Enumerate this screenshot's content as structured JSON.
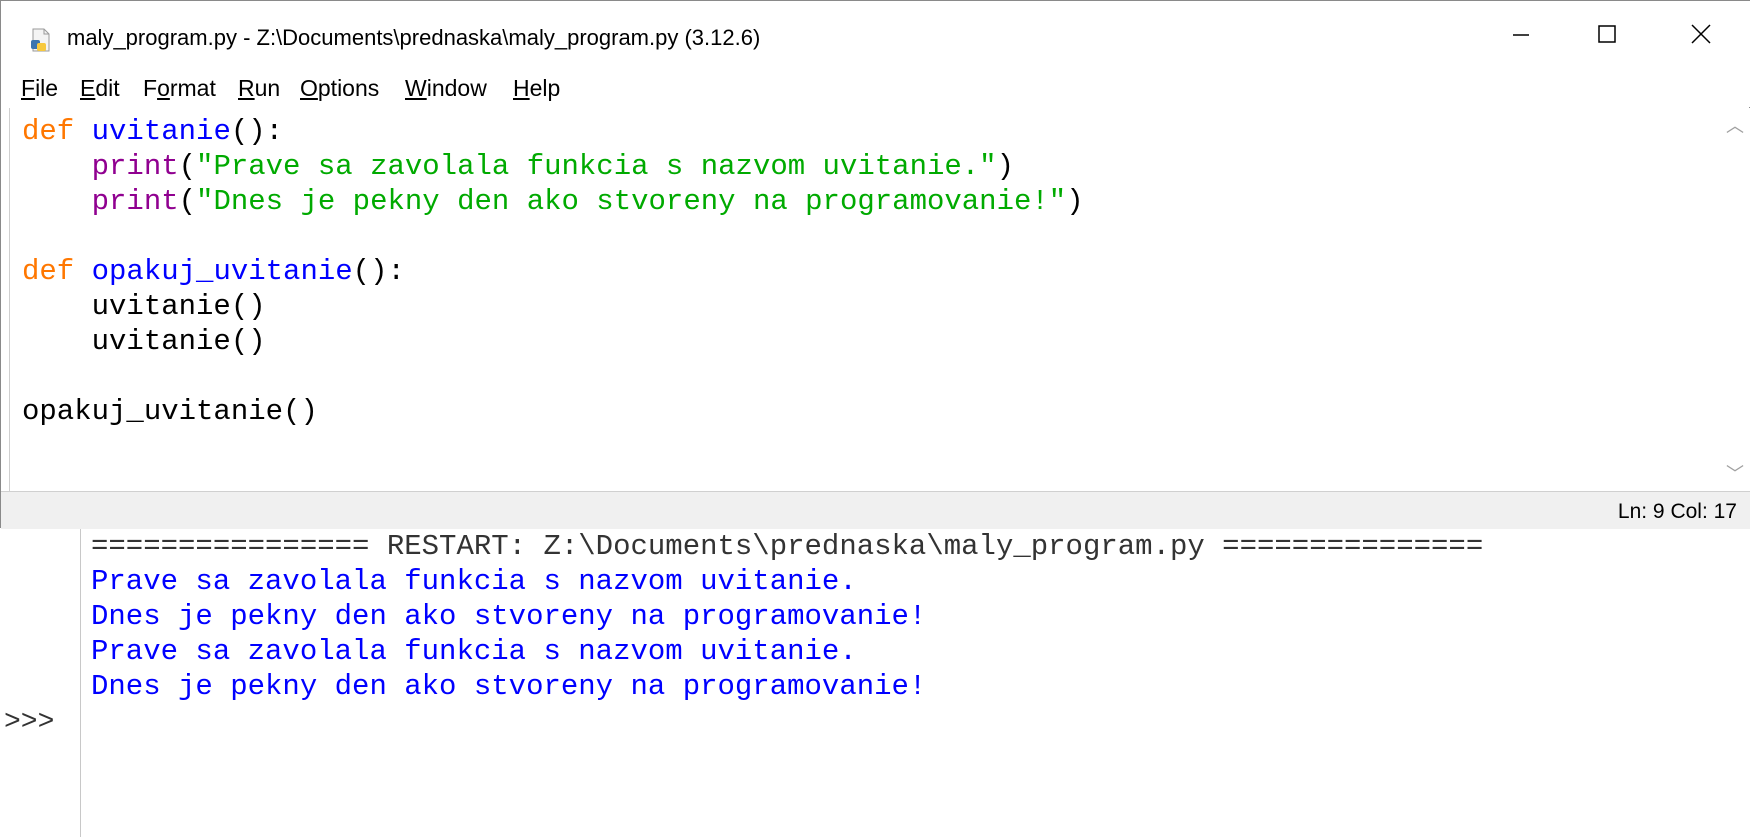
{
  "window": {
    "title": "maly_program.py - Z:\\Documents\\prednaska\\maly_program.py (3.12.6)",
    "icon": "python-file-icon"
  },
  "menu": [
    {
      "label": "File",
      "mnemonic": "F",
      "rest": "ile"
    },
    {
      "label": "Edit",
      "mnemonic": "E",
      "rest": "dit"
    },
    {
      "label": "Format",
      "pre": "F",
      "mnemonic": "o",
      "rest": "rmat"
    },
    {
      "label": "Run",
      "mnemonic": "R",
      "rest": "un"
    },
    {
      "label": "Options",
      "mnemonic": "O",
      "rest": "ptions"
    },
    {
      "label": "Window",
      "mnemonic": "W",
      "rest": "indow"
    },
    {
      "label": "Help",
      "mnemonic": "H",
      "rest": "elp"
    }
  ],
  "code": {
    "l1_kw": "def",
    "l1_name": "uvitanie",
    "l1_rest": "():",
    "l2_indent": "    ",
    "l2_fn": "print",
    "l2_open": "(",
    "l2_str": "\"Prave sa zavolala funkcia s nazvom uvitanie.\"",
    "l2_close": ")",
    "l3_fn": "print",
    "l3_open": "(",
    "l3_str": "\"Dnes je pekny den ako stvoreny na programovanie!\"",
    "l3_close": ")",
    "l5_kw": "def",
    "l5_name": "opakuj_uvitanie",
    "l5_rest": "():",
    "l6": "    uvitanie()",
    "l7": "    uvitanie()",
    "l9": "opakuj_uvitanie()"
  },
  "status": {
    "ln_col": "Ln: 9   Col: 17"
  },
  "shell": {
    "restart_line": "================ RESTART: Z:\\Documents\\prednaska\\maly_program.py ===============",
    "output": [
      "Prave sa zavolala funkcia s nazvom uvitanie.",
      "Dnes je pekny den ako stvoreny na programovanie!",
      "Prave sa zavolala funkcia s nazvom uvitanie.",
      "Dnes je pekny den ako stvoreny na programovanie!"
    ],
    "prompt": ">>>"
  },
  "colors": {
    "keyword": "#ff7700",
    "definition": "#0000ff",
    "builtin": "#900090",
    "string": "#00aa00",
    "shell_output": "#0000ff"
  }
}
